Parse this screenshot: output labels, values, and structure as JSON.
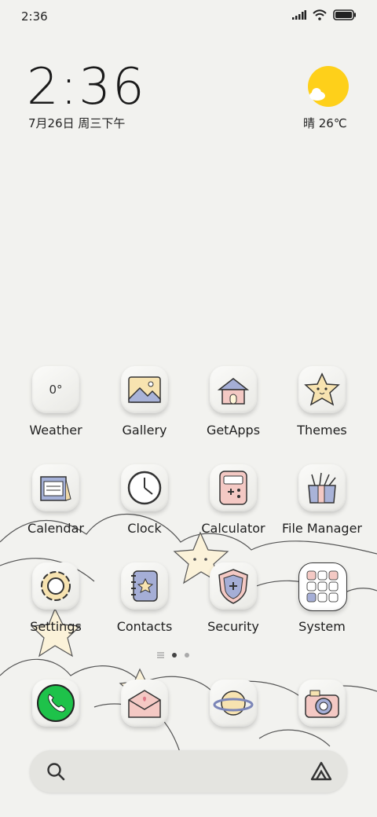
{
  "status_bar": {
    "time": "2:36"
  },
  "clock_widget": {
    "time": "2:36",
    "date": "7月26日 周三下午"
  },
  "weather_widget": {
    "text": "晴 26℃"
  },
  "apps": [
    {
      "label": "Weather",
      "badge": "0°",
      "icon": "weather-icon"
    },
    {
      "label": "Gallery",
      "icon": "gallery-icon"
    },
    {
      "label": "GetApps",
      "icon": "getapps-house-icon"
    },
    {
      "label": "Themes",
      "icon": "themes-star-icon"
    },
    {
      "label": "Calendar",
      "icon": "calendar-icon"
    },
    {
      "label": "Clock",
      "icon": "clock-icon"
    },
    {
      "label": "Calculator",
      "icon": "calculator-icon"
    },
    {
      "label": "File Manager",
      "icon": "file-manager-icon"
    },
    {
      "label": "Settings",
      "icon": "settings-gear-icon"
    },
    {
      "label": "Contacts",
      "icon": "contacts-book-icon"
    },
    {
      "label": "Security",
      "icon": "security-shield-icon"
    },
    {
      "label": "System",
      "icon": "system-folder-icon"
    }
  ],
  "dock": [
    {
      "icon": "phone-icon"
    },
    {
      "icon": "messages-envelope-icon"
    },
    {
      "icon": "browser-planet-icon"
    },
    {
      "icon": "camera-icon"
    }
  ],
  "colors": {
    "background": "#f2f2ef",
    "sun": "#fed01a",
    "phone_green": "#1ec24a"
  }
}
